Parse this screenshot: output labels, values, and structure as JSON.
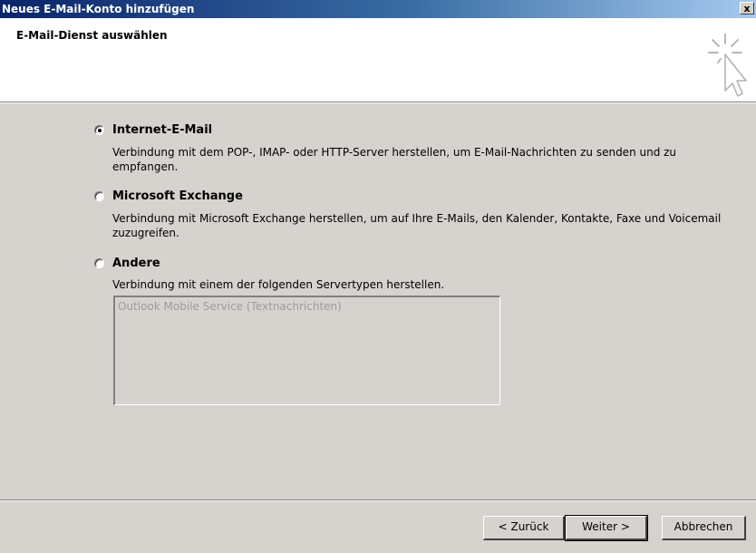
{
  "window": {
    "title": "Neues E-Mail-Konto hinzufügen",
    "close_label": "x"
  },
  "header": {
    "heading": "E-Mail-Dienst auswählen",
    "icon": "wizard-cursor-icon"
  },
  "options": [
    {
      "label": "Internet-E-Mail",
      "selected": true,
      "description": "Verbindung mit dem POP-, IMAP- oder HTTP-Server herstellen, um E-Mail-Nachrichten zu senden und zu empfangen."
    },
    {
      "label": "Microsoft Exchange",
      "selected": false,
      "description": "Verbindung mit Microsoft Exchange herstellen, um auf Ihre E-Mails, den Kalender, Kontakte, Faxe und Voicemail zuzugreifen."
    },
    {
      "label": "Andere",
      "selected": false,
      "description": "Verbindung mit einem der folgenden Servertypen herstellen."
    }
  ],
  "server_types": [
    "Outlook Mobile Service (Textnachrichten)"
  ],
  "buttons": {
    "back": "< Zurück",
    "next": "Weiter >",
    "cancel": "Abbrechen"
  }
}
